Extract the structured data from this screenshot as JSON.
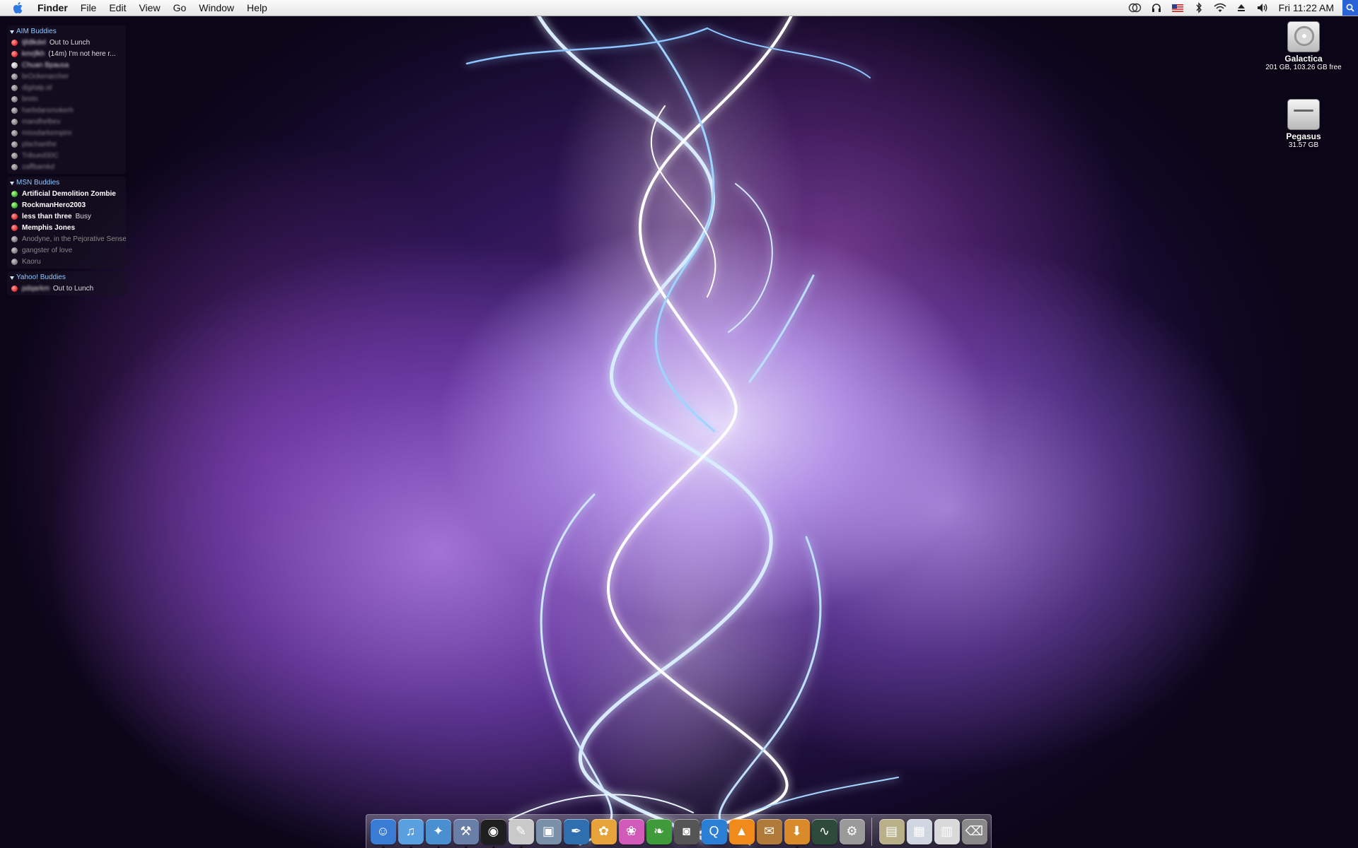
{
  "menubar": {
    "app_name": "Finder",
    "menus": [
      "File",
      "Edit",
      "View",
      "Go",
      "Window",
      "Help"
    ],
    "clock": "Fri 11:22 AM",
    "status_icons": [
      "timemachine-icon",
      "headphones-icon",
      "us-flag-icon",
      "bluetooth-icon",
      "wifi-icon",
      "eject-icon",
      "volume-icon"
    ],
    "colors": {
      "bar": "#ececec",
      "spotlight": "#2a63d6"
    }
  },
  "buddy_list": {
    "groups": [
      {
        "name": "AIM Buddies",
        "buddies": [
          {
            "name": "tjfdlkdel",
            "status": "Out to Lunch",
            "state": "away",
            "blurred": true
          },
          {
            "name": "kmrjfkh",
            "status": "(14m) I'm not here r...",
            "state": "away",
            "blurred": true
          },
          {
            "name": "Chuan Bpausa",
            "status": "",
            "state": "idle",
            "blurred": true
          },
          {
            "name": "brOckenarcher",
            "status": "",
            "state": "offline",
            "blurred": true
          },
          {
            "name": "digitalp.id",
            "status": "",
            "state": "offline",
            "blurred": true
          },
          {
            "name": "bretn",
            "status": "",
            "state": "offline",
            "blurred": true
          },
          {
            "name": "harbdarsmokerh",
            "status": "",
            "state": "offline",
            "blurred": true
          },
          {
            "name": "mandhelbev",
            "status": "",
            "state": "offline",
            "blurred": true
          },
          {
            "name": "missdarkempire",
            "status": "",
            "state": "offline",
            "blurred": true
          },
          {
            "name": "plachaethe",
            "status": "",
            "state": "offline",
            "blurred": true
          },
          {
            "name": "Tribued30C",
            "status": "",
            "state": "offline",
            "blurred": true
          },
          {
            "name": "zaffbamkd",
            "status": "",
            "state": "offline",
            "blurred": true
          }
        ]
      },
      {
        "name": "MSN Buddies",
        "buddies": [
          {
            "name": "Artificial Demolition Zombie",
            "status": "",
            "state": "online",
            "blurred": false
          },
          {
            "name": "RockmanHero2003",
            "status": "",
            "state": "online",
            "blurred": false
          },
          {
            "name": "less than three",
            "status": "Busy",
            "state": "away",
            "blurred": false
          },
          {
            "name": "Memphis Jones",
            "status": "",
            "state": "away",
            "blurred": false
          },
          {
            "name": "Anodyne, in the Pejorative Sense",
            "status": "",
            "state": "offline",
            "blurred": false
          },
          {
            "name": "gangster of love",
            "status": "",
            "state": "offline",
            "blurred": false
          },
          {
            "name": "Kaoru",
            "status": "",
            "state": "offline",
            "blurred": false
          }
        ]
      },
      {
        "name": "Yahoo! Buddies",
        "buddies": [
          {
            "name": "pdqarkm",
            "status": "Out to Lunch",
            "state": "away",
            "blurred": true
          }
        ]
      }
    ]
  },
  "desktop": {
    "drives": [
      {
        "name": "Galactica",
        "info": "201 GB, 103.26 GB free"
      },
      {
        "name": "Pegasus",
        "info": "31.57 GB"
      }
    ]
  },
  "dock": {
    "apps": [
      {
        "name": "finder-icon",
        "glyph": "☺",
        "color": "#3a7bd5",
        "running": true
      },
      {
        "name": "itunes-icon",
        "glyph": "♫",
        "color": "#5aa0e0",
        "running": true
      },
      {
        "name": "safari-icon",
        "glyph": "✦",
        "color": "#4a90d0",
        "running": true
      },
      {
        "name": "xcode-icon",
        "glyph": "⚒",
        "color": "#6a7fa8",
        "running": true
      },
      {
        "name": "adium-icon",
        "glyph": "◉",
        "color": "#1f1f1f",
        "running": true
      },
      {
        "name": "textedit-icon",
        "glyph": "✎",
        "color": "#c9c9c9",
        "running": true
      },
      {
        "name": "preview-icon",
        "glyph": "▣",
        "color": "#7a8fa8",
        "running": false
      },
      {
        "name": "quill-icon",
        "glyph": "✒",
        "color": "#2f6fb0",
        "running": false
      },
      {
        "name": "iphoto-icon",
        "glyph": "✿",
        "color": "#e8a23a",
        "running": false
      },
      {
        "name": "butterfly-icon",
        "glyph": "❀",
        "color": "#d25ab8",
        "running": false
      },
      {
        "name": "leaf-icon",
        "glyph": "❧",
        "color": "#3f9a3a",
        "running": false
      },
      {
        "name": "camera-icon",
        "glyph": "◙",
        "color": "#555555",
        "running": false
      },
      {
        "name": "quicktime-icon",
        "glyph": "Q",
        "color": "#2a7fd5",
        "running": false
      },
      {
        "name": "vlc-icon",
        "glyph": "▲",
        "color": "#f08a1a",
        "running": false
      },
      {
        "name": "dictionary-icon",
        "glyph": "✉",
        "color": "#b07a3a",
        "running": false
      },
      {
        "name": "transmission-icon",
        "glyph": "⬇",
        "color": "#d98a2a",
        "running": true
      },
      {
        "name": "activity-monitor-icon",
        "glyph": "∿",
        "color": "#2e4a3a",
        "running": false
      },
      {
        "name": "system-prefs-icon",
        "glyph": "⚙",
        "color": "#9a9a9a",
        "running": false
      }
    ],
    "stacks": [
      {
        "name": "documents-folder-icon",
        "glyph": "▤",
        "color": "#b9b08a"
      },
      {
        "name": "image-stack-icon",
        "glyph": "▦",
        "color": "#cfd6e0"
      },
      {
        "name": "document-stack-icon",
        "glyph": "▥",
        "color": "#d9d9d9"
      },
      {
        "name": "trash-icon",
        "glyph": "⌫",
        "color": "#8a8a8a"
      }
    ]
  }
}
